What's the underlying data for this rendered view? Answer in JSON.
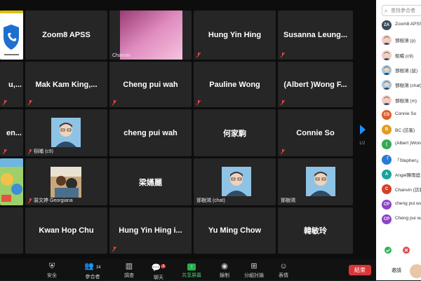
{
  "tiles": [
    {
      "name": "",
      "caption": ""
    },
    {
      "name": "Zoom8 APSS",
      "caption": ""
    },
    {
      "name": "",
      "caption": "Chanvin"
    },
    {
      "name": "Hung Yin Hing",
      "caption": ""
    },
    {
      "name": "Susanna Leung...",
      "caption": ""
    },
    {
      "name": "u,...",
      "caption": ""
    },
    {
      "name": "Mak Kam King,...",
      "caption": ""
    },
    {
      "name": "Cheng pui wah",
      "caption": ""
    },
    {
      "name": "Pauline Wong",
      "caption": ""
    },
    {
      "name": "(Albert )Wong F...",
      "caption": ""
    },
    {
      "name": "en...",
      "caption": ""
    },
    {
      "name": "",
      "caption": "栩晡 (c9)"
    },
    {
      "name": "cheng pui wah",
      "caption": ""
    },
    {
      "name": "何家駒",
      "caption": ""
    },
    {
      "name": "Connie So",
      "caption": ""
    },
    {
      "name": "",
      "caption": ""
    },
    {
      "name": "",
      "caption": "裴文婷 Georgiana"
    },
    {
      "name": "梁嬿麗",
      "caption": ""
    },
    {
      "name": "",
      "caption": "鄧樹鴻 (chat)"
    },
    {
      "name": "",
      "caption": "鄧樹鴻"
    },
    {
      "name": "",
      "caption": ""
    },
    {
      "name": "Kwan  Hop Chu",
      "caption": ""
    },
    {
      "name": "Hung Yin Hing i...",
      "caption": ""
    },
    {
      "name": "Yu Ming Chow",
      "caption": ""
    },
    {
      "name": "韓敏玲",
      "caption": ""
    }
  ],
  "pager": {
    "page": "1/2"
  },
  "toolbar": {
    "security": "安全",
    "participants": "參合者",
    "participants_count": "34",
    "polls": "調查",
    "chat": "聊天",
    "chat_badge": "3",
    "share": "共享屏幕",
    "record": "錄制",
    "breakout": "分組討論",
    "reactions": "表情",
    "end": "結束"
  },
  "sidebar": {
    "search_placeholder": "查找參合者",
    "participants": [
      {
        "initials": "ZA",
        "name": "Zoom8 APSS",
        "color": "#3c4a5c"
      },
      {
        "initials": "",
        "name": "鄧樹鴻 (p)",
        "color": "#f3c9c3"
      },
      {
        "initials": "",
        "name": "栩晡 (c9)",
        "color": "#f3c9c3"
      },
      {
        "initials": "",
        "name": "鄧樹鴻 (鼠)",
        "color": "#9fc7e6"
      },
      {
        "initials": "",
        "name": "鄧樹鴻 (chat)",
        "color": "#9fc7e6"
      },
      {
        "initials": "",
        "name": "鄧樹鴻 (m)",
        "color": "#f3c9c3"
      },
      {
        "initials": "CS",
        "name": "Connie So",
        "color": "#e05c2b"
      },
      {
        "initials": "B",
        "name": "BC (訪客)",
        "color": "#e79a1b"
      },
      {
        "initials": "(",
        "name": "(Albert )Wong",
        "color": "#35a853"
      },
      {
        "initials": "「",
        "name": "「Stephen」",
        "color": "#2a7bd4"
      },
      {
        "initials": "A",
        "name": "Angel陳雨庭",
        "color": "#1aa39b"
      },
      {
        "initials": "C",
        "name": "Chanvin (訪客)",
        "color": "#d6402a"
      },
      {
        "initials": "CP",
        "name": "cheng pui wah",
        "color": "#8a44c6"
      },
      {
        "initials": "CP",
        "name": "Cheng pui wah",
        "color": "#8a44c6"
      }
    ],
    "invite": "邀請"
  }
}
